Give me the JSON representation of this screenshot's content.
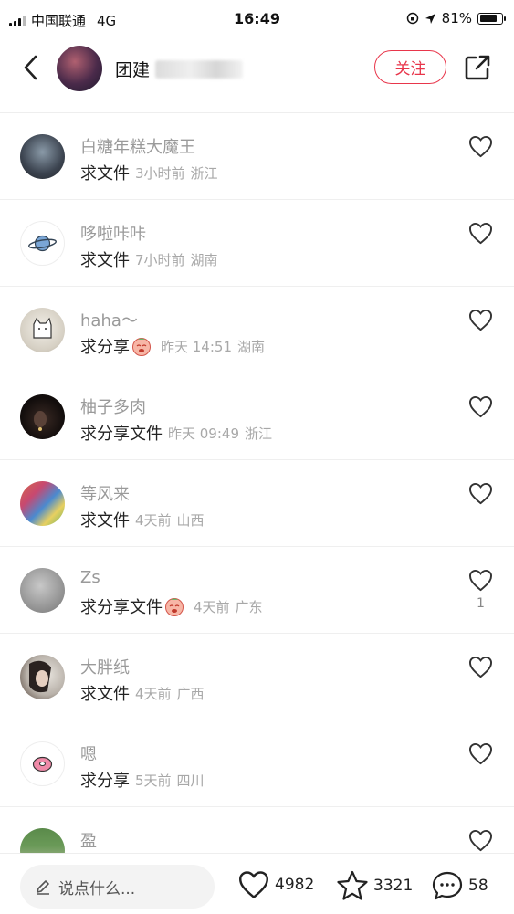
{
  "status_bar": {
    "carrier": "中国联通",
    "network": "4G",
    "time": "16:49",
    "battery": "81%",
    "battery_level": 0.81
  },
  "header": {
    "title": "团建",
    "follow_label": "关注"
  },
  "comments": [
    {
      "username": "白糖年糕大魔王",
      "text": "求文件",
      "time": "3小时前",
      "location": "浙江",
      "has_emoji": false,
      "likes": ""
    },
    {
      "username": "哆啦咔咔",
      "text": "求文件",
      "time": "7小时前",
      "location": "湖南",
      "has_emoji": false,
      "likes": ""
    },
    {
      "username": "haha～",
      "text": "求分享",
      "time": "昨天 14:51",
      "location": "湖南",
      "has_emoji": true,
      "likes": ""
    },
    {
      "username": "柚子多肉",
      "text": "求分享文件",
      "time": "昨天 09:49",
      "location": "浙江",
      "has_emoji": false,
      "likes": ""
    },
    {
      "username": "等风来",
      "text": "求文件",
      "time": "4天前",
      "location": "山西",
      "has_emoji": false,
      "likes": ""
    },
    {
      "username": " Zs",
      "text": "求分享文件",
      "time": "4天前",
      "location": "广东",
      "has_emoji": true,
      "likes": "1"
    },
    {
      "username": "大胖纸",
      "text": "求文件",
      "time": "4天前",
      "location": "广西",
      "has_emoji": false,
      "likes": ""
    },
    {
      "username": " 嗯",
      "text": "求分享",
      "time": "5天前",
      "location": "四川",
      "has_emoji": false,
      "likes": ""
    },
    {
      "username": " 盈",
      "text": "",
      "time": "",
      "location": "",
      "has_emoji": false,
      "likes": ""
    }
  ],
  "bottom_bar": {
    "input_placeholder": "说点什么...",
    "like_count": "4982",
    "favorite_count": "3321",
    "comment_count": "58"
  },
  "colors": {
    "accent": "#e8364b",
    "username": "#9a9a9a",
    "meta": "#a8a8a8"
  },
  "icons": [
    "back-arrow-icon",
    "share-out-icon",
    "heart-icon",
    "star-icon",
    "comment-bubble-icon",
    "pencil-icon",
    "location-arrow-icon",
    "lock-rotation-icon"
  ]
}
